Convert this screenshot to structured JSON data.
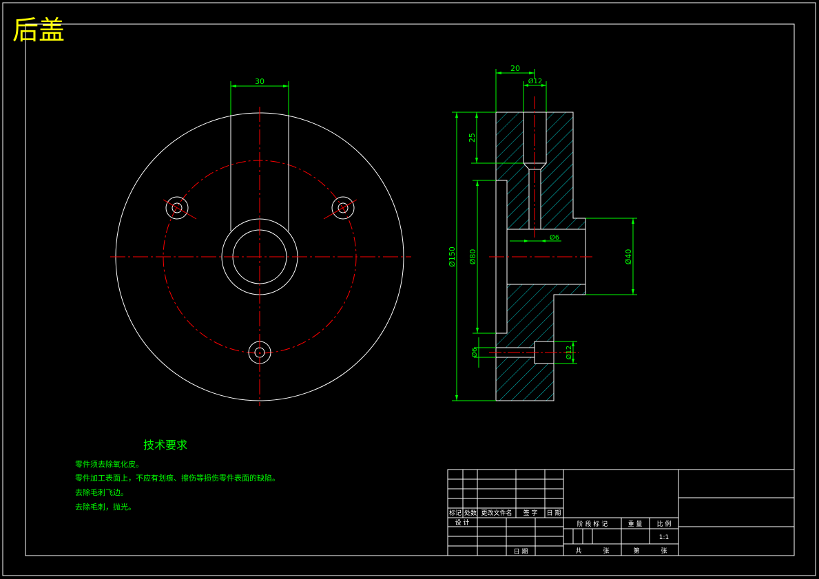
{
  "title": "后盖",
  "colors": {
    "background": "#000000",
    "outline": "#ffffff",
    "centerline": "#ff0000",
    "dimension": "#00ff00",
    "hatch": "#00ffff",
    "title": "#ffff00"
  },
  "front_view": {
    "dim_slot_width": "30"
  },
  "section_view": {
    "dim_top_width": "20",
    "dim_top_hole": "Ø12",
    "dim_top_depth": "25",
    "dim_outer_diameter": "Ø150",
    "dim_recess_diameter": "Ø80",
    "dim_small_hole": "Ø6",
    "dim_hub_diameter": "Ø40",
    "dim_bottom_small_hole": "Ø6",
    "dim_bottom_counterbore": "Ø12"
  },
  "tech_requirements": {
    "heading": "技术要求",
    "items": [
      "零件须去除氧化皮。",
      "零件加工表面上，不应有划痕、擦伤等损伤零件表面的缺陷。",
      "去除毛刺飞边。",
      "去除毛刺，抛光。"
    ]
  },
  "title_block": {
    "row_labels": [
      "标记",
      "处数",
      "更改文件名",
      "签 字",
      "日 期"
    ],
    "design_label": "设 计",
    "approve_label": "日 期",
    "stage_label": "阶 段 标 记",
    "weight_label": "重 量",
    "scale_label": "比 例",
    "scale_value": "1:1",
    "sheets_total": "共",
    "sheets_unit": "张",
    "sheet_no": "第",
    "sheet_unit": "张"
  }
}
